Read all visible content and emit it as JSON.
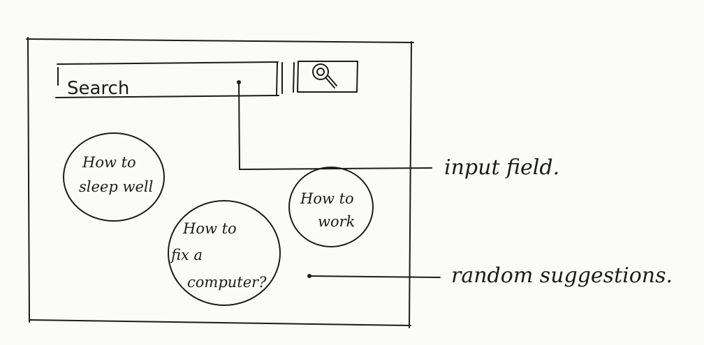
{
  "search": {
    "placeholder": "Search",
    "button_icon": "magnifier-icon"
  },
  "suggestions": [
    {
      "lines": [
        "How to",
        "sleep well"
      ]
    },
    {
      "lines": [
        "How to",
        "work"
      ]
    },
    {
      "lines": [
        "How to",
        "fix a",
        "computer?"
      ]
    }
  ],
  "annotations": {
    "input_field": "input field.",
    "random_suggestions": "random suggestions."
  },
  "colors": {
    "ink": "#1b1b1b",
    "paper": "#fbfbf9"
  }
}
